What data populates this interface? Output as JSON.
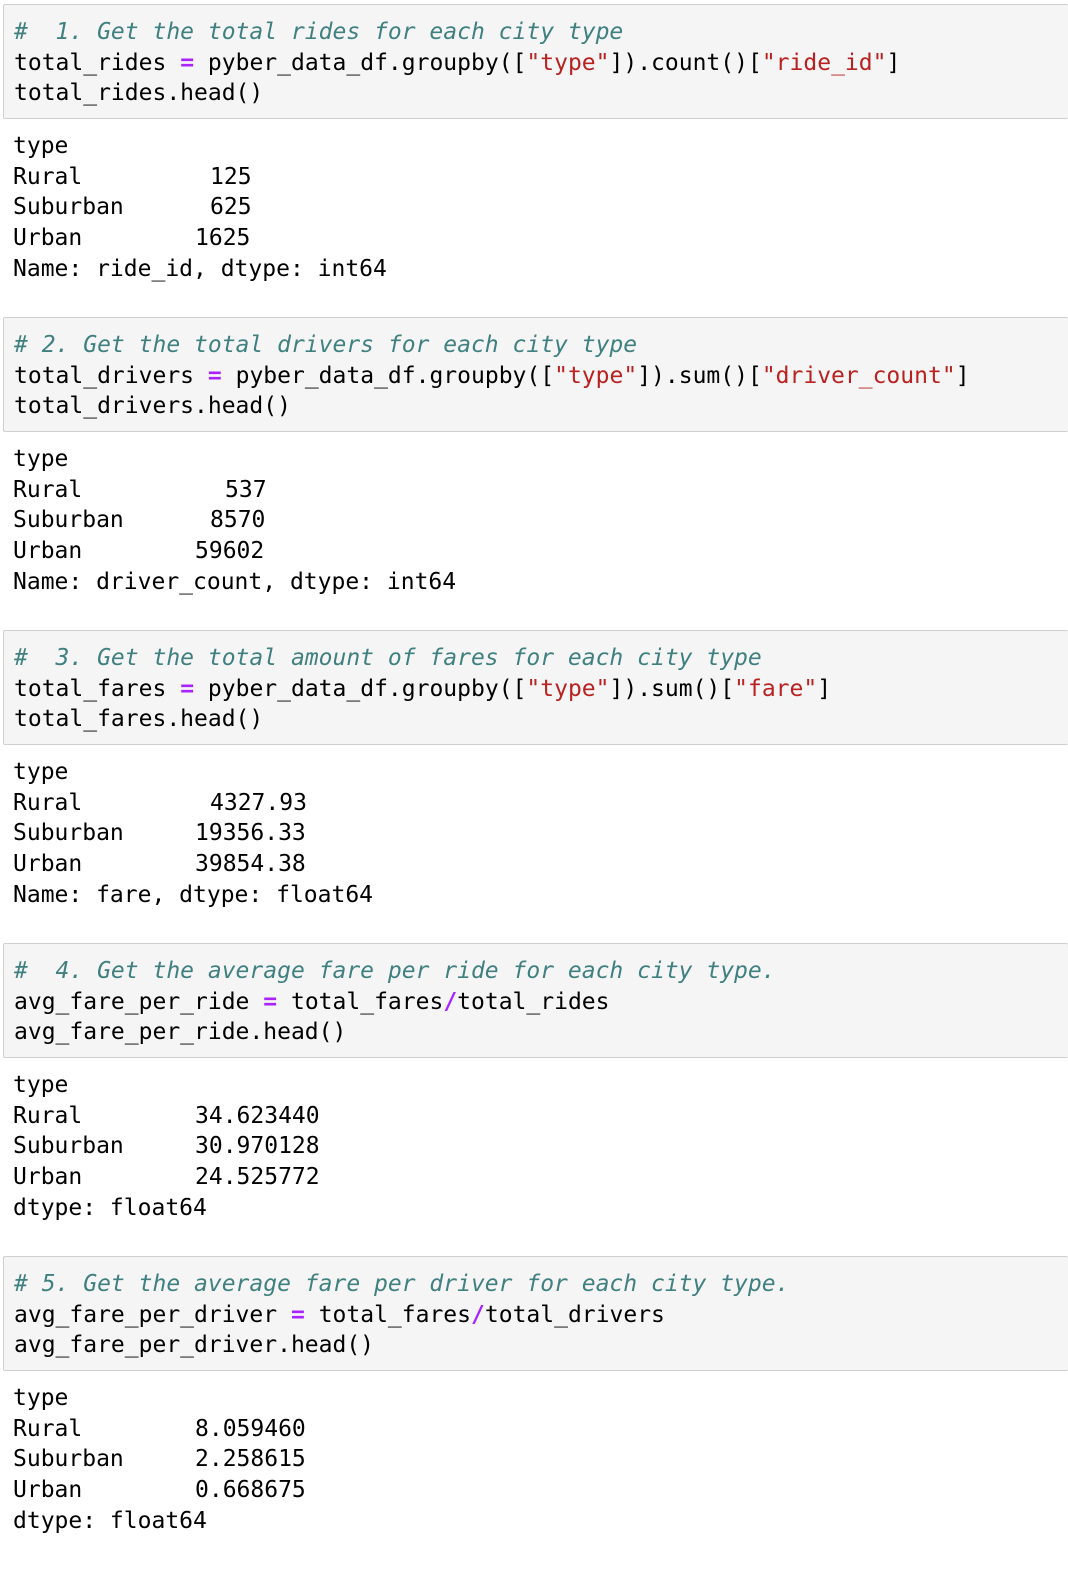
{
  "cells": [
    {
      "comment": "#  1. Get the total rides for each city type",
      "code1": {
        "var": "total_rides",
        "op": "=",
        "expr_a": "pyber_data_df.groupby([",
        "str1": "\"type\"",
        "expr_b": "]).count()[",
        "str2": "\"ride_id\"",
        "expr_c": "]"
      },
      "code2": "total_rides.head()",
      "output": {
        "index_name": "type",
        "rows": [
          {
            "label": "Rural",
            "value": "125"
          },
          {
            "label": "Suburban",
            "value": "625"
          },
          {
            "label": "Urban",
            "value": "1625"
          }
        ],
        "footer": "Name: ride_id, dtype: int64"
      }
    },
    {
      "comment": "# 2. Get the total drivers for each city type",
      "code1": {
        "var": "total_drivers",
        "op": "=",
        "expr_a": "pyber_data_df.groupby([",
        "str1": "\"type\"",
        "expr_b": "]).sum()[",
        "str2": "\"driver_count\"",
        "expr_c": "]"
      },
      "code2": "total_drivers.head()",
      "output": {
        "index_name": "type",
        "rows": [
          {
            "label": "Rural",
            "value": "537"
          },
          {
            "label": "Suburban",
            "value": "8570"
          },
          {
            "label": "Urban",
            "value": "59602"
          }
        ],
        "footer": "Name: driver_count, dtype: int64"
      }
    },
    {
      "comment": "#  3. Get the total amount of fares for each city type",
      "code1": {
        "var": "total_fares",
        "op": "=",
        "expr_a": "pyber_data_df.groupby([",
        "str1": "\"type\"",
        "expr_b": "]).sum()[",
        "str2": "\"fare\"",
        "expr_c": "]"
      },
      "code2": "total_fares.head()",
      "output": {
        "index_name": "type",
        "rows": [
          {
            "label": "Rural",
            "value": "4327.93"
          },
          {
            "label": "Suburban",
            "value": "19356.33"
          },
          {
            "label": "Urban",
            "value": "39854.38"
          }
        ],
        "footer": "Name: fare, dtype: float64"
      }
    },
    {
      "comment": "#  4. Get the average fare per ride for each city type.",
      "code1": {
        "var": "avg_fare_per_ride",
        "op": "=",
        "left": "total_fares",
        "div": "/",
        "right": "total_rides"
      },
      "code2": "avg_fare_per_ride.head()",
      "output": {
        "index_name": "type",
        "rows": [
          {
            "label": "Rural",
            "value": "34.623440"
          },
          {
            "label": "Suburban",
            "value": "30.970128"
          },
          {
            "label": "Urban",
            "value": "24.525772"
          }
        ],
        "footer": "dtype: float64"
      }
    },
    {
      "comment": "# 5. Get the average fare per driver for each city type.",
      "code1": {
        "var": "avg_fare_per_driver",
        "op": "=",
        "left": "total_fares",
        "div": "/",
        "right": "total_drivers"
      },
      "code2": "avg_fare_per_driver.head()",
      "output": {
        "index_name": "type",
        "rows": [
          {
            "label": "Rural",
            "value": "8.059460"
          },
          {
            "label": "Suburban",
            "value": "2.258615"
          },
          {
            "label": "Urban",
            "value": "0.668675"
          }
        ],
        "footer": "dtype: float64"
      }
    }
  ]
}
